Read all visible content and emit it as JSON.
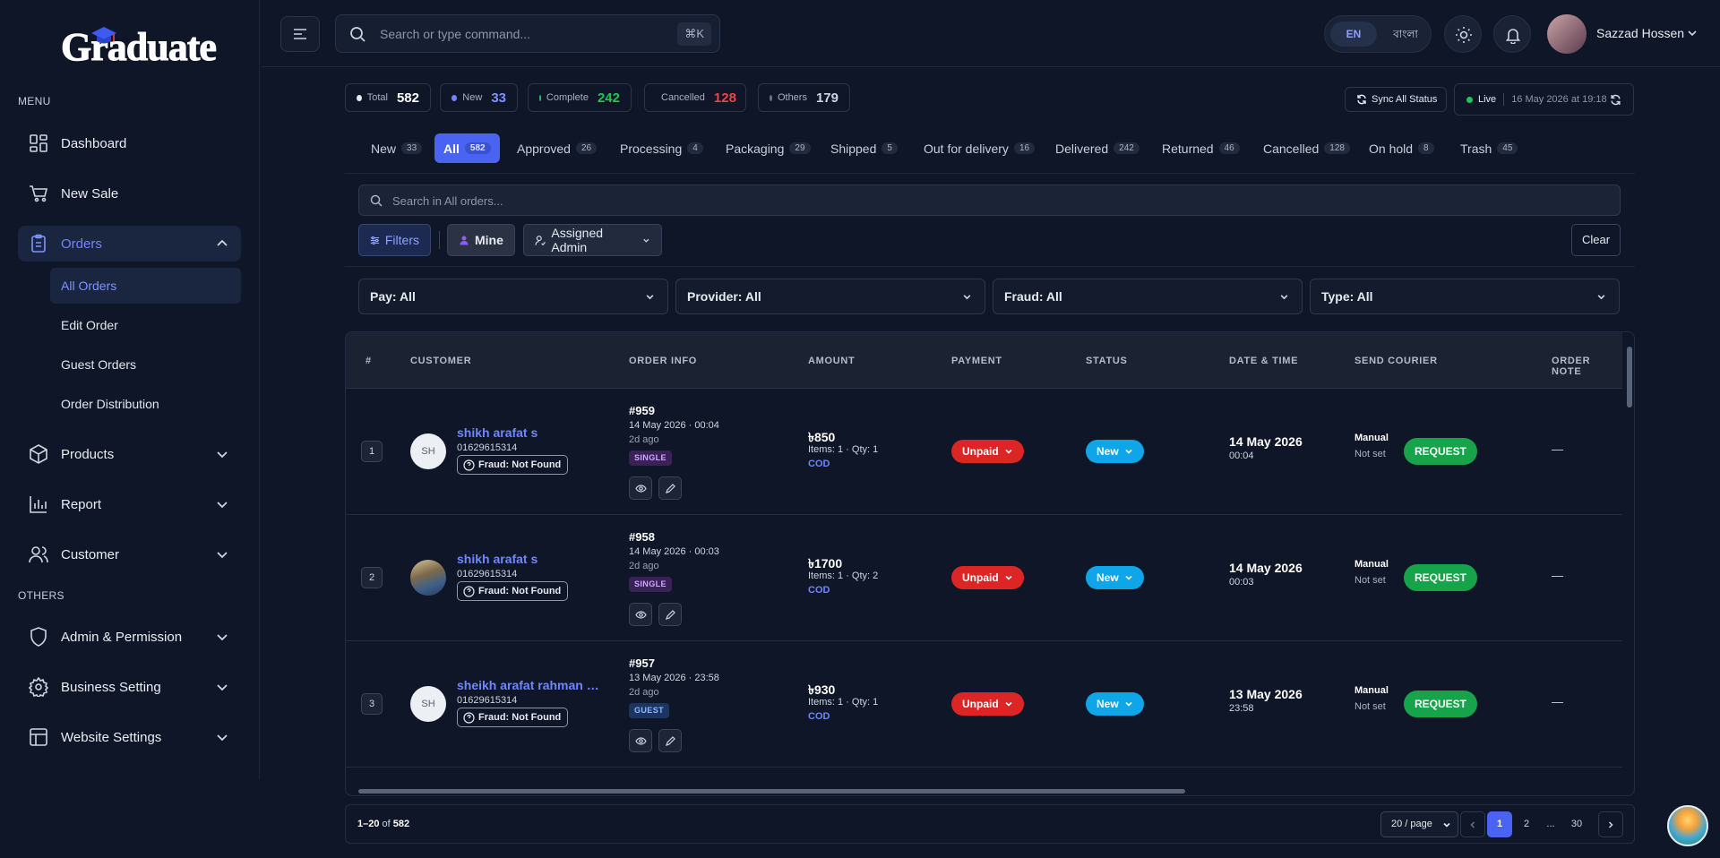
{
  "brand": {
    "logo_text": "Graduate"
  },
  "sidebar": {
    "menu_label": "MENU",
    "others_label": "OTHERS",
    "items": [
      {
        "label": "Dashboard",
        "icon": "dashboard-icon"
      },
      {
        "label": "New Sale",
        "icon": "cart-icon"
      },
      {
        "label": "Orders",
        "icon": "clipboard-icon",
        "expanded": true
      },
      {
        "label": "Products",
        "icon": "box-icon"
      },
      {
        "label": "Report",
        "icon": "bar-chart-icon"
      },
      {
        "label": "Customer",
        "icon": "users-icon"
      }
    ],
    "orders_sub": [
      "All Orders",
      "Edit Order",
      "Guest Orders",
      "Order Distribution"
    ],
    "others": [
      {
        "label": "Admin & Permission",
        "icon": "shield-icon"
      },
      {
        "label": "Business Setting",
        "icon": "gear-icon"
      },
      {
        "label": "Website Settings",
        "icon": "layout-icon"
      }
    ]
  },
  "topbar": {
    "search_placeholder": "Search or type command...",
    "shortcut": "⌘K",
    "lang_en": "EN",
    "lang_bn": "বাংলা",
    "user_name": "Sazzad Hossen"
  },
  "stats": {
    "total_label": "Total",
    "total": "582",
    "new_label": "New",
    "new": "33",
    "complete_label": "Complete",
    "complete": "242",
    "cancelled_label": "Cancelled",
    "cancelled": "128",
    "others_label": "Others",
    "others": "179",
    "sync_label": "Sync All Status",
    "live_label": "Live",
    "live_time": "16 May 2026 at 19:18"
  },
  "colors": {
    "accent": "#4a63f2",
    "unpaid": "#dc2626",
    "new_status": "#0ea5e9",
    "request": "#16a34a",
    "complete": "#21c45d",
    "cancelled": "#ef4444"
  },
  "tabs": [
    {
      "label": "New",
      "count": "33"
    },
    {
      "label": "All",
      "count": "582"
    },
    {
      "label": "Approved",
      "count": "26"
    },
    {
      "label": "Processing",
      "count": "4"
    },
    {
      "label": "Packaging",
      "count": "29"
    },
    {
      "label": "Shipped",
      "count": "5"
    },
    {
      "label": "Out for delivery",
      "count": "16"
    },
    {
      "label": "Delivered",
      "count": "242"
    },
    {
      "label": "Returned",
      "count": "46"
    },
    {
      "label": "Cancelled",
      "count": "128"
    },
    {
      "label": "On hold",
      "count": "8"
    },
    {
      "label": "Trash",
      "count": "45"
    }
  ],
  "orders_search_placeholder": "Search in All orders...",
  "filter_bar": {
    "filters": "Filters",
    "mine": "Mine",
    "assigned": "Assigned Admin",
    "clear": "Clear"
  },
  "dropdowns": {
    "pay": "Pay: All",
    "provider": "Provider: All",
    "fraud": "Fraud: All",
    "type": "Type: All"
  },
  "table": {
    "headers": [
      "#",
      "CUSTOMER",
      "ORDER INFO",
      "AMOUNT",
      "PAYMENT",
      "STATUS",
      "DATE & TIME",
      "SEND COURIER",
      "ORDER NOTE"
    ],
    "rows": [
      {
        "idx": "1",
        "initials": "SH",
        "name": "shikh arafat s",
        "phone": "01629615314",
        "fraud": "Fraud: Not Found",
        "order_id": "#959",
        "order_date": "14 May 2026 · 00:04",
        "ago": "2d ago",
        "type": "SINGLE",
        "amount": "৳850",
        "items": "Items: 1 · Qty: 1",
        "method": "COD",
        "payment": "Unpaid",
        "status": "New",
        "date": "14 May 2026",
        "time": "00:04",
        "courier_mode": "Manual",
        "courier_state": "Not set",
        "request": "REQUEST",
        "note": "—"
      },
      {
        "idx": "2",
        "initials": "",
        "name": "shikh arafat s",
        "phone": "01629615314",
        "fraud": "Fraud: Not Found",
        "order_id": "#958",
        "order_date": "14 May 2026 · 00:03",
        "ago": "2d ago",
        "type": "SINGLE",
        "amount": "৳1700",
        "items": "Items: 1 · Qty: 2",
        "method": "COD",
        "payment": "Unpaid",
        "status": "New",
        "date": "14 May 2026",
        "time": "00:03",
        "courier_mode": "Manual",
        "courier_state": "Not set",
        "request": "REQUEST",
        "note": "—"
      },
      {
        "idx": "3",
        "initials": "SH",
        "name": "sheikh arafat rahman sh...",
        "phone": "01629615314",
        "fraud": "Fraud: Not Found",
        "order_id": "#957",
        "order_date": "13 May 2026 · 23:58",
        "ago": "2d ago",
        "type": "GUEST",
        "amount": "৳930",
        "items": "Items: 1 · Qty: 1",
        "method": "COD",
        "payment": "Unpaid",
        "status": "New",
        "date": "13 May 2026",
        "time": "23:58",
        "courier_mode": "Manual",
        "courier_state": "Not set",
        "request": "REQUEST",
        "note": "—"
      }
    ]
  },
  "footer": {
    "range": "1–20",
    "of": "of",
    "total": "582",
    "per_page": "20 / page",
    "pages": [
      "1",
      "2",
      "...",
      "30"
    ]
  }
}
